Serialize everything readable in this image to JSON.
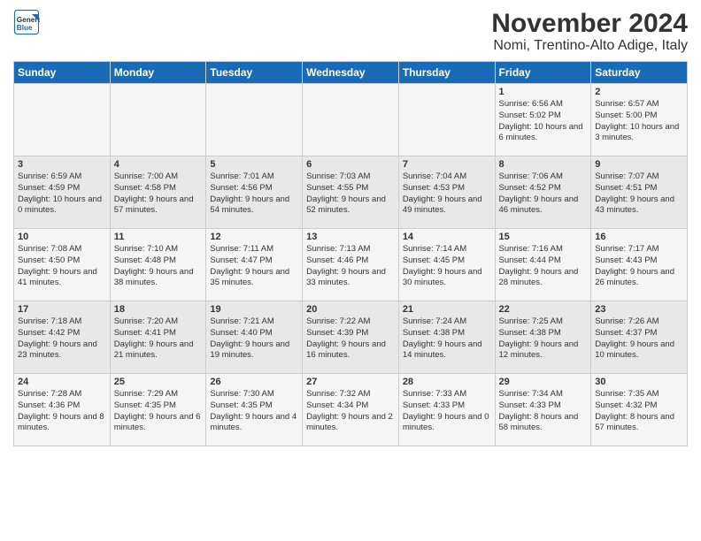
{
  "header": {
    "logo_line1": "General",
    "logo_line2": "Blue",
    "title": "November 2024",
    "subtitle": "Nomi, Trentino-Alto Adige, Italy"
  },
  "days_of_week": [
    "Sunday",
    "Monday",
    "Tuesday",
    "Wednesday",
    "Thursday",
    "Friday",
    "Saturday"
  ],
  "weeks": [
    [
      {
        "day": "",
        "info": ""
      },
      {
        "day": "",
        "info": ""
      },
      {
        "day": "",
        "info": ""
      },
      {
        "day": "",
        "info": ""
      },
      {
        "day": "",
        "info": ""
      },
      {
        "day": "1",
        "info": "Sunrise: 6:56 AM\nSunset: 5:02 PM\nDaylight: 10 hours and 6 minutes."
      },
      {
        "day": "2",
        "info": "Sunrise: 6:57 AM\nSunset: 5:00 PM\nDaylight: 10 hours and 3 minutes."
      }
    ],
    [
      {
        "day": "3",
        "info": "Sunrise: 6:59 AM\nSunset: 4:59 PM\nDaylight: 10 hours and 0 minutes."
      },
      {
        "day": "4",
        "info": "Sunrise: 7:00 AM\nSunset: 4:58 PM\nDaylight: 9 hours and 57 minutes."
      },
      {
        "day": "5",
        "info": "Sunrise: 7:01 AM\nSunset: 4:56 PM\nDaylight: 9 hours and 54 minutes."
      },
      {
        "day": "6",
        "info": "Sunrise: 7:03 AM\nSunset: 4:55 PM\nDaylight: 9 hours and 52 minutes."
      },
      {
        "day": "7",
        "info": "Sunrise: 7:04 AM\nSunset: 4:53 PM\nDaylight: 9 hours and 49 minutes."
      },
      {
        "day": "8",
        "info": "Sunrise: 7:06 AM\nSunset: 4:52 PM\nDaylight: 9 hours and 46 minutes."
      },
      {
        "day": "9",
        "info": "Sunrise: 7:07 AM\nSunset: 4:51 PM\nDaylight: 9 hours and 43 minutes."
      }
    ],
    [
      {
        "day": "10",
        "info": "Sunrise: 7:08 AM\nSunset: 4:50 PM\nDaylight: 9 hours and 41 minutes."
      },
      {
        "day": "11",
        "info": "Sunrise: 7:10 AM\nSunset: 4:48 PM\nDaylight: 9 hours and 38 minutes."
      },
      {
        "day": "12",
        "info": "Sunrise: 7:11 AM\nSunset: 4:47 PM\nDaylight: 9 hours and 35 minutes."
      },
      {
        "day": "13",
        "info": "Sunrise: 7:13 AM\nSunset: 4:46 PM\nDaylight: 9 hours and 33 minutes."
      },
      {
        "day": "14",
        "info": "Sunrise: 7:14 AM\nSunset: 4:45 PM\nDaylight: 9 hours and 30 minutes."
      },
      {
        "day": "15",
        "info": "Sunrise: 7:16 AM\nSunset: 4:44 PM\nDaylight: 9 hours and 28 minutes."
      },
      {
        "day": "16",
        "info": "Sunrise: 7:17 AM\nSunset: 4:43 PM\nDaylight: 9 hours and 26 minutes."
      }
    ],
    [
      {
        "day": "17",
        "info": "Sunrise: 7:18 AM\nSunset: 4:42 PM\nDaylight: 9 hours and 23 minutes."
      },
      {
        "day": "18",
        "info": "Sunrise: 7:20 AM\nSunset: 4:41 PM\nDaylight: 9 hours and 21 minutes."
      },
      {
        "day": "19",
        "info": "Sunrise: 7:21 AM\nSunset: 4:40 PM\nDaylight: 9 hours and 19 minutes."
      },
      {
        "day": "20",
        "info": "Sunrise: 7:22 AM\nSunset: 4:39 PM\nDaylight: 9 hours and 16 minutes."
      },
      {
        "day": "21",
        "info": "Sunrise: 7:24 AM\nSunset: 4:38 PM\nDaylight: 9 hours and 14 minutes."
      },
      {
        "day": "22",
        "info": "Sunrise: 7:25 AM\nSunset: 4:38 PM\nDaylight: 9 hours and 12 minutes."
      },
      {
        "day": "23",
        "info": "Sunrise: 7:26 AM\nSunset: 4:37 PM\nDaylight: 9 hours and 10 minutes."
      }
    ],
    [
      {
        "day": "24",
        "info": "Sunrise: 7:28 AM\nSunset: 4:36 PM\nDaylight: 9 hours and 8 minutes."
      },
      {
        "day": "25",
        "info": "Sunrise: 7:29 AM\nSunset: 4:35 PM\nDaylight: 9 hours and 6 minutes."
      },
      {
        "day": "26",
        "info": "Sunrise: 7:30 AM\nSunset: 4:35 PM\nDaylight: 9 hours and 4 minutes."
      },
      {
        "day": "27",
        "info": "Sunrise: 7:32 AM\nSunset: 4:34 PM\nDaylight: 9 hours and 2 minutes."
      },
      {
        "day": "28",
        "info": "Sunrise: 7:33 AM\nSunset: 4:33 PM\nDaylight: 9 hours and 0 minutes."
      },
      {
        "day": "29",
        "info": "Sunrise: 7:34 AM\nSunset: 4:33 PM\nDaylight: 8 hours and 58 minutes."
      },
      {
        "day": "30",
        "info": "Sunrise: 7:35 AM\nSunset: 4:32 PM\nDaylight: 8 hours and 57 minutes."
      }
    ]
  ]
}
